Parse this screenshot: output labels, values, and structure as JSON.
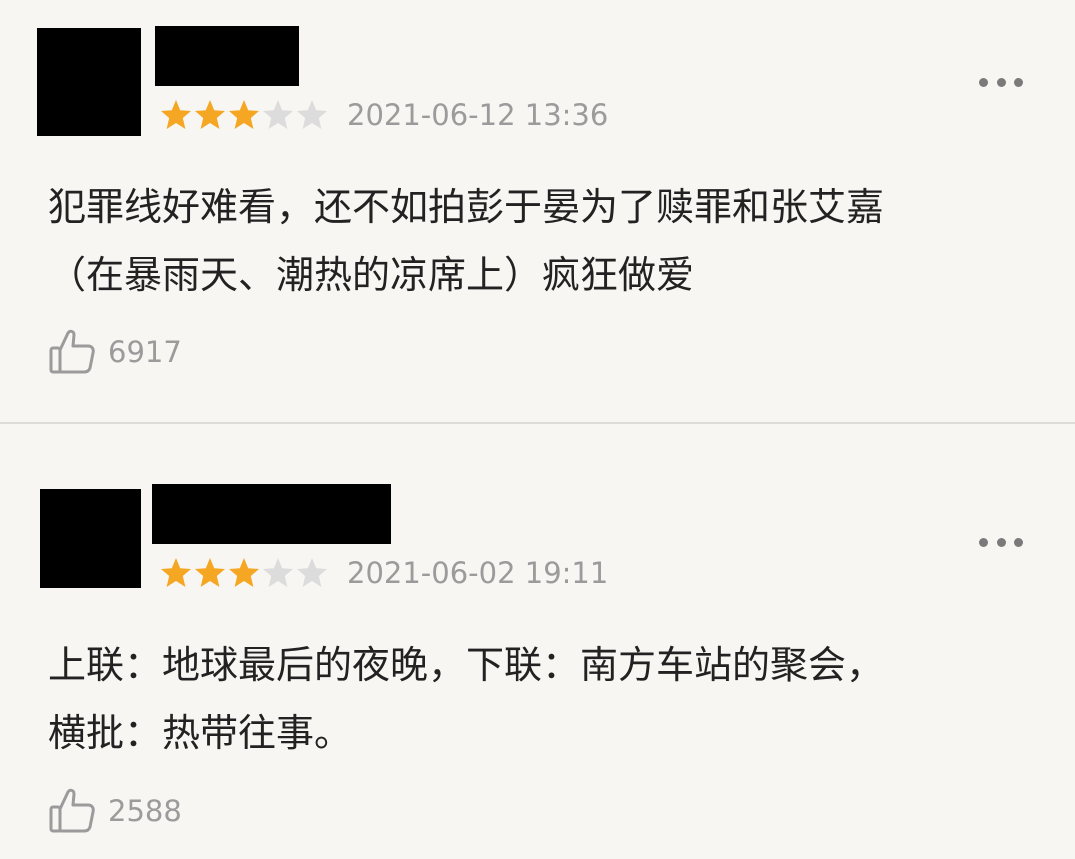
{
  "colors": {
    "background": "#f8f6f3",
    "star_filled": "#f5a623",
    "star_empty": "#dcdcdc",
    "meta_text": "#9b9b9b",
    "body_text": "#222222"
  },
  "reviews": [
    {
      "rating": 3,
      "max_rating": 5,
      "timestamp": "2021-06-12 13:36",
      "content": "犯罪线好难看，还不如拍彭于晏为了赎罪和张艾嘉\n（在暴雨天、潮热的凉席上）疯狂做爱",
      "likes": "6917",
      "icons": {
        "more": "more-dots-icon",
        "like": "thumbs-up-icon"
      }
    },
    {
      "rating": 3,
      "max_rating": 5,
      "timestamp": "2021-06-02 19:11",
      "content": "上联：地球最后的夜晚，下联：南方车站的聚会，\n横批：热带往事。",
      "likes": "2588",
      "icons": {
        "more": "more-dots-icon",
        "like": "thumbs-up-icon"
      }
    }
  ]
}
